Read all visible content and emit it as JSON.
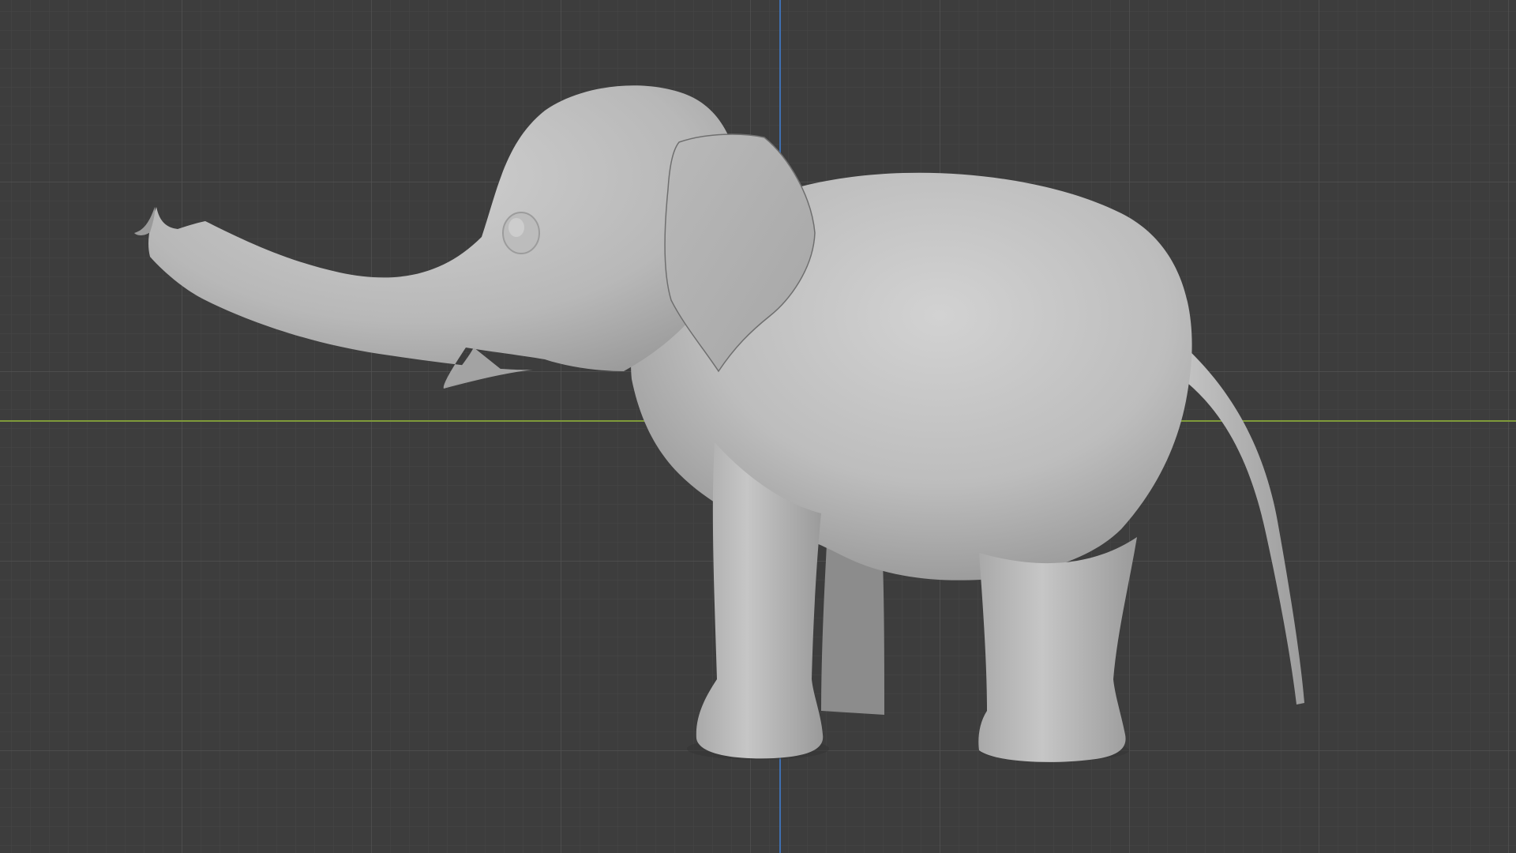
{
  "viewport": {
    "background_color": "#3d3d3d",
    "grid_minor_color": "#474747",
    "grid_major_color": "#525252",
    "x_axis_color": "#7f9a3a",
    "z_axis_color": "#3f6fb0",
    "object": {
      "name_icon": "elephant-mesh",
      "shading": "solid",
      "base_color": "#b4b4b4"
    }
  }
}
